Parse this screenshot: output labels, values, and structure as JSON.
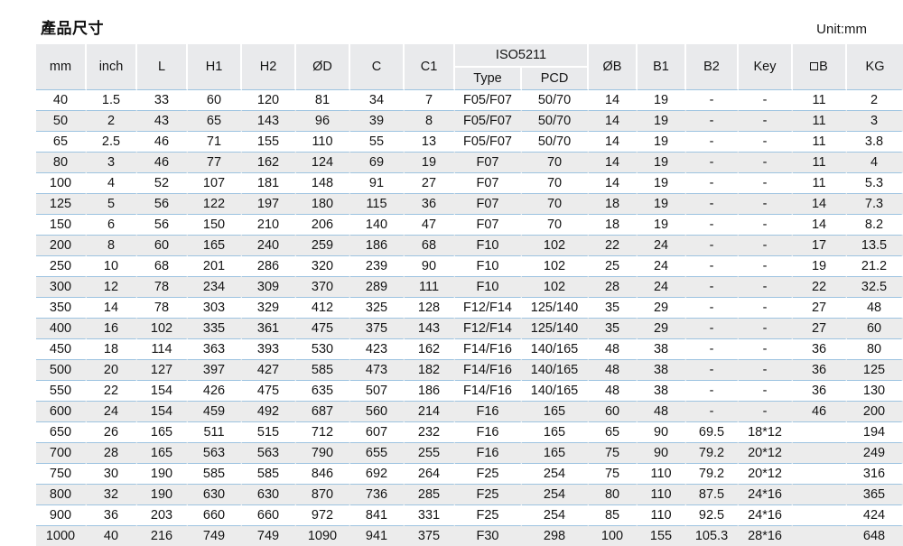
{
  "title": "產品尺寸",
  "unit_label": "Unit:mm",
  "accent_rule_color": "#9dc3e0",
  "header_bg": "#e9eaec",
  "stripe_bg": "#ececec",
  "table": {
    "group_header": {
      "iso_label": "ISO5211",
      "iso_sub": [
        "Type",
        "PCD"
      ]
    },
    "columns": [
      "mm",
      "inch",
      "L",
      "H1",
      "H2",
      "ØD",
      "C",
      "C1",
      "Type",
      "PCD",
      "ØB",
      "B1",
      "B2",
      "Key",
      "□B",
      "KG"
    ],
    "column_square_icon_index": 14,
    "rows": [
      [
        "40",
        "1.5",
        "33",
        "60",
        "120",
        "81",
        "34",
        "7",
        "F05/F07",
        "50/70",
        "14",
        "19",
        "-",
        "-",
        "11",
        "2"
      ],
      [
        "50",
        "2",
        "43",
        "65",
        "143",
        "96",
        "39",
        "8",
        "F05/F07",
        "50/70",
        "14",
        "19",
        "-",
        "-",
        "11",
        "3"
      ],
      [
        "65",
        "2.5",
        "46",
        "71",
        "155",
        "110",
        "55",
        "13",
        "F05/F07",
        "50/70",
        "14",
        "19",
        "-",
        "-",
        "11",
        "3.8"
      ],
      [
        "80",
        "3",
        "46",
        "77",
        "162",
        "124",
        "69",
        "19",
        "F07",
        "70",
        "14",
        "19",
        "-",
        "-",
        "11",
        "4"
      ],
      [
        "100",
        "4",
        "52",
        "107",
        "181",
        "148",
        "91",
        "27",
        "F07",
        "70",
        "14",
        "19",
        "-",
        "-",
        "11",
        "5.3"
      ],
      [
        "125",
        "5",
        "56",
        "122",
        "197",
        "180",
        "115",
        "36",
        "F07",
        "70",
        "18",
        "19",
        "-",
        "-",
        "14",
        "7.3"
      ],
      [
        "150",
        "6",
        "56",
        "150",
        "210",
        "206",
        "140",
        "47",
        "F07",
        "70",
        "18",
        "19",
        "-",
        "-",
        "14",
        "8.2"
      ],
      [
        "200",
        "8",
        "60",
        "165",
        "240",
        "259",
        "186",
        "68",
        "F10",
        "102",
        "22",
        "24",
        "-",
        "-",
        "17",
        "13.5"
      ],
      [
        "250",
        "10",
        "68",
        "201",
        "286",
        "320",
        "239",
        "90",
        "F10",
        "102",
        "25",
        "24",
        "-",
        "-",
        "19",
        "21.2"
      ],
      [
        "300",
        "12",
        "78",
        "234",
        "309",
        "370",
        "289",
        "111",
        "F10",
        "102",
        "28",
        "24",
        "-",
        "-",
        "22",
        "32.5"
      ],
      [
        "350",
        "14",
        "78",
        "303",
        "329",
        "412",
        "325",
        "128",
        "F12/F14",
        "125/140",
        "35",
        "29",
        "-",
        "-",
        "27",
        "48"
      ],
      [
        "400",
        "16",
        "102",
        "335",
        "361",
        "475",
        "375",
        "143",
        "F12/F14",
        "125/140",
        "35",
        "29",
        "-",
        "-",
        "27",
        "60"
      ],
      [
        "450",
        "18",
        "114",
        "363",
        "393",
        "530",
        "423",
        "162",
        "F14/F16",
        "140/165",
        "48",
        "38",
        "-",
        "-",
        "36",
        "80"
      ],
      [
        "500",
        "20",
        "127",
        "397",
        "427",
        "585",
        "473",
        "182",
        "F14/F16",
        "140/165",
        "48",
        "38",
        "-",
        "-",
        "36",
        "125"
      ],
      [
        "550",
        "22",
        "154",
        "426",
        "475",
        "635",
        "507",
        "186",
        "F14/F16",
        "140/165",
        "48",
        "38",
        "-",
        "-",
        "36",
        "130"
      ],
      [
        "600",
        "24",
        "154",
        "459",
        "492",
        "687",
        "560",
        "214",
        "F16",
        "165",
        "60",
        "48",
        "-",
        "-",
        "46",
        "200"
      ],
      [
        "650",
        "26",
        "165",
        "511",
        "515",
        "712",
        "607",
        "232",
        "F16",
        "165",
        "65",
        "90",
        "69.5",
        "18*12",
        "",
        "194"
      ],
      [
        "700",
        "28",
        "165",
        "563",
        "563",
        "790",
        "655",
        "255",
        "F16",
        "165",
        "75",
        "90",
        "79.2",
        "20*12",
        "",
        "249"
      ],
      [
        "750",
        "30",
        "190",
        "585",
        "585",
        "846",
        "692",
        "264",
        "F25",
        "254",
        "75",
        "110",
        "79.2",
        "20*12",
        "",
        "316"
      ],
      [
        "800",
        "32",
        "190",
        "630",
        "630",
        "870",
        "736",
        "285",
        "F25",
        "254",
        "80",
        "110",
        "87.5",
        "24*16",
        "",
        "365"
      ],
      [
        "900",
        "36",
        "203",
        "660",
        "660",
        "972",
        "841",
        "331",
        "F25",
        "254",
        "85",
        "110",
        "92.5",
        "24*16",
        "",
        "424"
      ],
      [
        "1000",
        "40",
        "216",
        "749",
        "749",
        "1090",
        "941",
        "375",
        "F30",
        "298",
        "100",
        "155",
        "105.3",
        "28*16",
        "",
        "648"
      ]
    ]
  }
}
